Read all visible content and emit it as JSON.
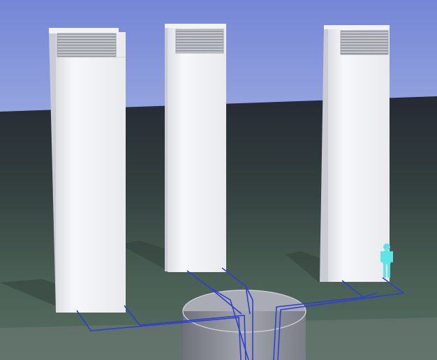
{
  "scene": {
    "subject": "three-white-ventilation-towers-with-underground-ducts",
    "colors": {
      "sky_top": "#7486d6",
      "sky_bottom": "#98a8e0",
      "ground_far": "#262a33",
      "ground_mid": "#3c4b48",
      "ground_near": "#52695c",
      "tower_face": "#f4f5f7",
      "tower_shade": "#d9dbe0",
      "grille": "#b9bcc2",
      "pipe": "#2f3fd0",
      "shaft": "#8d9099",
      "person": "#5fe4e6"
    },
    "towers": [
      {
        "name": "left-tower"
      },
      {
        "name": "middle-tower"
      },
      {
        "name": "right-tower"
      }
    ]
  }
}
